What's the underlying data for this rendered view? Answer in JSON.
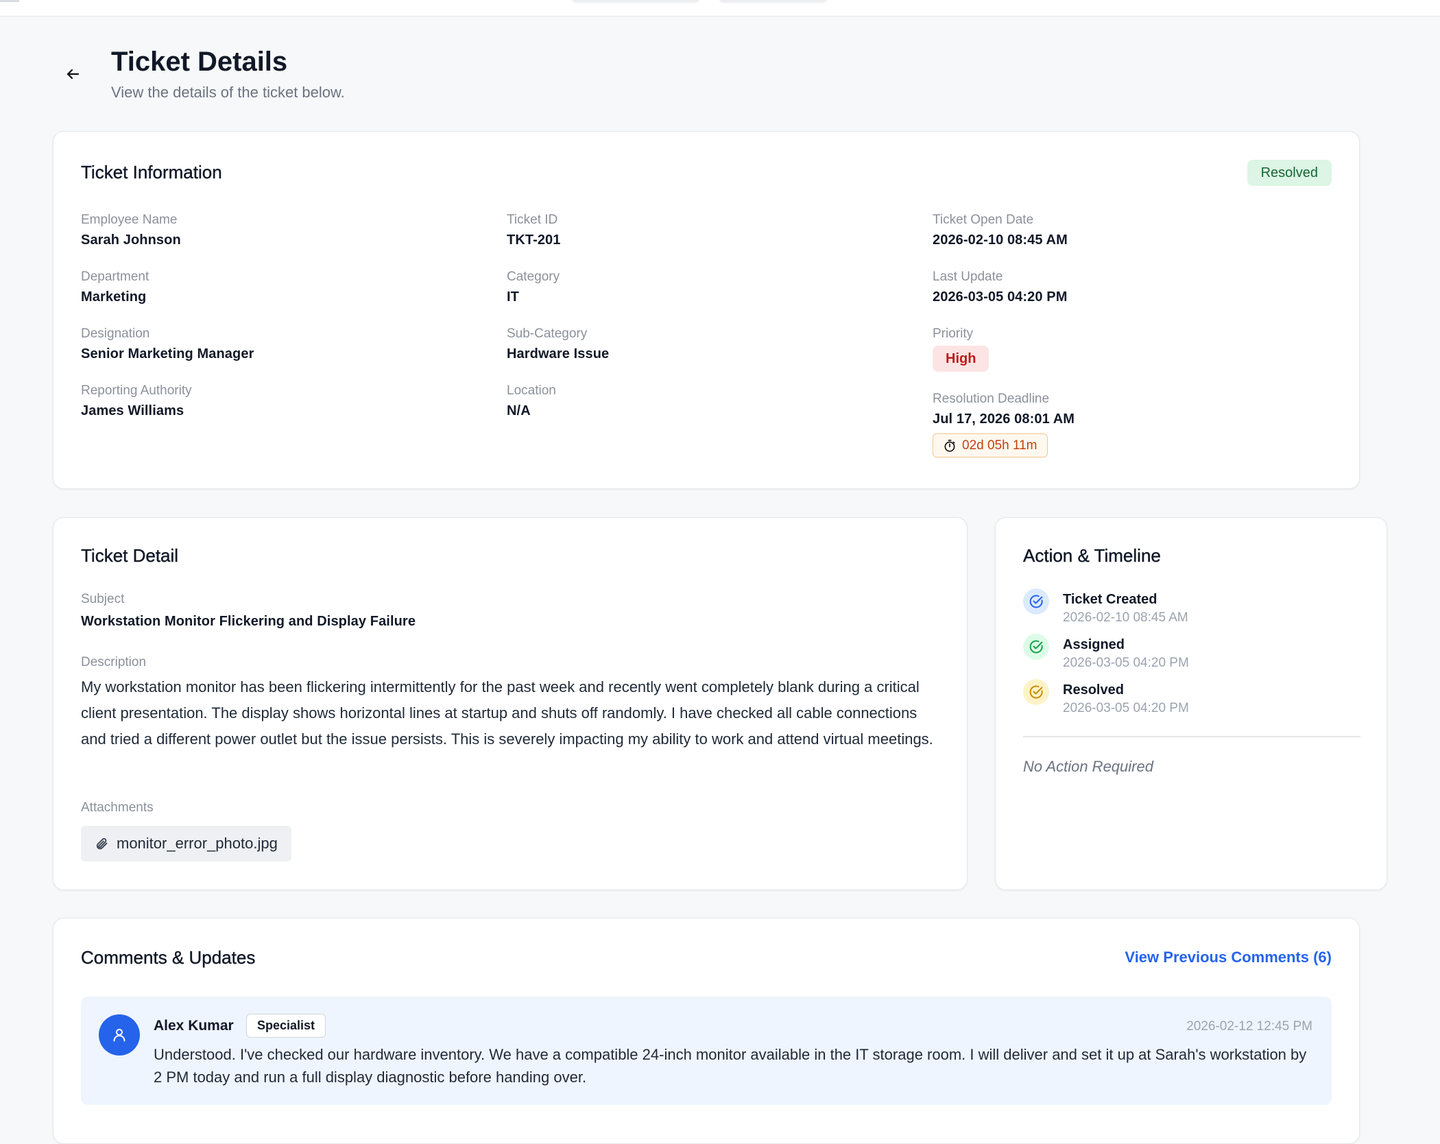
{
  "header": {
    "title": "Ticket Details",
    "subtitle": "View the details of the ticket below."
  },
  "info": {
    "title": "Ticket Information",
    "status": "Resolved",
    "employee_name": {
      "label": "Employee Name",
      "value": "Sarah Johnson"
    },
    "department": {
      "label": "Department",
      "value": "Marketing"
    },
    "designation": {
      "label": "Designation",
      "value": "Senior Marketing Manager"
    },
    "reporting_authority": {
      "label": "Reporting Authority",
      "value": "James Williams"
    },
    "ticket_id": {
      "label": "Ticket ID",
      "value": "TKT-201"
    },
    "category": {
      "label": "Category",
      "value": "IT"
    },
    "sub_category": {
      "label": "Sub-Category",
      "value": "Hardware Issue"
    },
    "location": {
      "label": "Location",
      "value": "N/A"
    },
    "open_date": {
      "label": "Ticket Open Date",
      "value": "2026-02-10 08:45 AM"
    },
    "last_update": {
      "label": "Last Update",
      "value": "2026-03-05 04:20 PM"
    },
    "priority": {
      "label": "Priority",
      "value": "High"
    },
    "deadline": {
      "label": "Resolution Deadline",
      "value": "Jul 17, 2026 08:01 AM",
      "countdown": "02d 05h 11m"
    }
  },
  "detail": {
    "title": "Ticket Detail",
    "subject_label": "Subject",
    "subject": "Workstation Monitor Flickering and Display Failure",
    "description_label": "Description",
    "description": "My workstation monitor has been flickering intermittently for the past week and recently went completely blank during a critical client presentation. The display shows horizontal lines at startup and shuts off randomly. I have checked all cable connections and tried a different power outlet but the issue persists. This is severely impacting my ability to work and attend virtual meetings.",
    "attachments_label": "Attachments",
    "attachment": "monitor_error_photo.jpg"
  },
  "timeline": {
    "title": "Action & Timeline",
    "items": [
      {
        "title": "Ticket Created",
        "time": "2026-02-10 08:45 AM",
        "color": "#2563eb",
        "bg": "#dbeafe"
      },
      {
        "title": "Assigned",
        "time": "2026-03-05 04:20 PM",
        "color": "#16a34a",
        "bg": "#dcfce7"
      },
      {
        "title": "Resolved",
        "time": "2026-03-05 04:20 PM",
        "color": "#ca8a04",
        "bg": "#fef3c7"
      }
    ],
    "no_action": "No Action Required"
  },
  "comments": {
    "title": "Comments & Updates",
    "view_previous": "View Previous Comments (6)",
    "items": [
      {
        "author": "Alex Kumar",
        "role": "Specialist",
        "time": "2026-02-12 12:45 PM",
        "text": "Understood. I've checked our hardware inventory. We have a compatible 24-inch monitor available in the IT storage room. I will deliver and set it up at Sarah's workstation by 2 PM today and run a full display diagnostic before handing over."
      }
    ]
  }
}
